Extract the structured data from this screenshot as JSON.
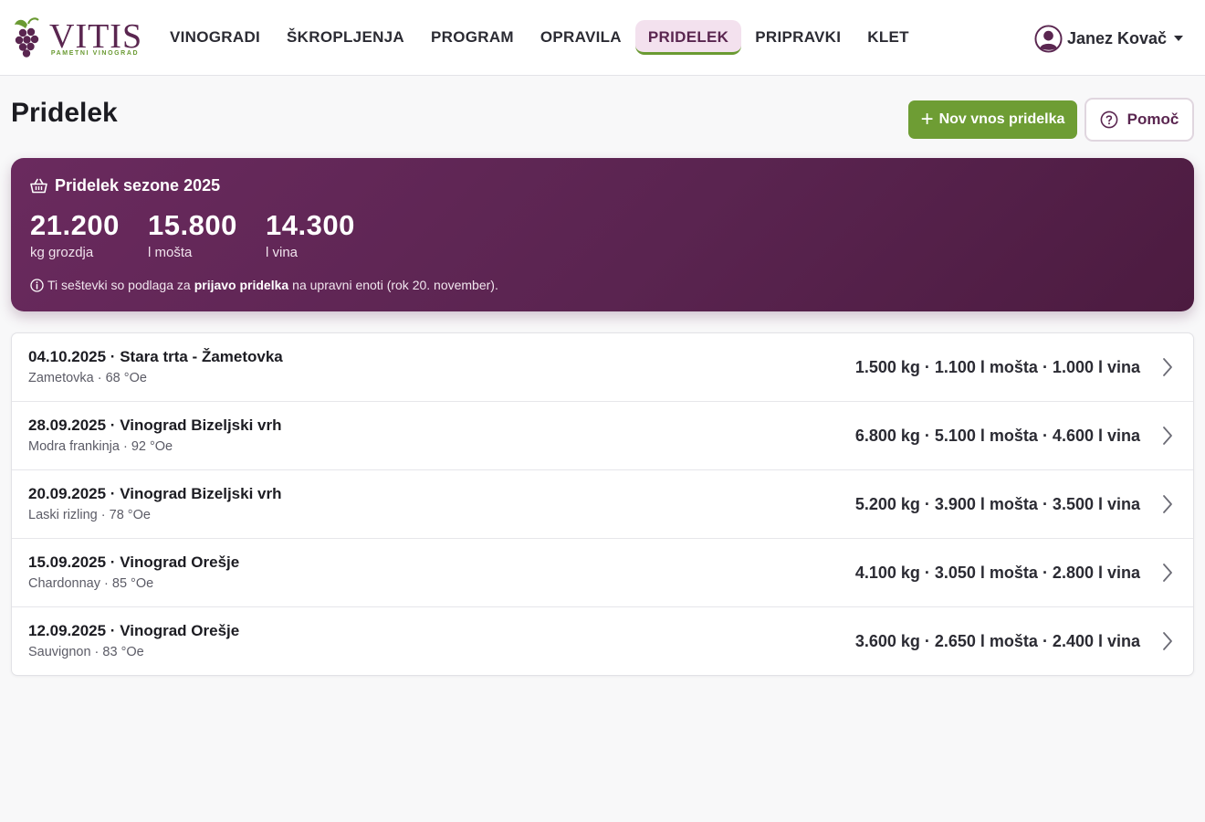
{
  "brand": {
    "name": "VITIS",
    "tagline": "PAMETNI VINOGRAD"
  },
  "nav": {
    "items": [
      {
        "label": "VINOGRADI",
        "active": false
      },
      {
        "label": "ŠKROPLJENJA",
        "active": false
      },
      {
        "label": "PROGRAM",
        "active": false
      },
      {
        "label": "OPRAVILA",
        "active": false
      },
      {
        "label": "PRIDELEK",
        "active": true
      },
      {
        "label": "PRIPRAVKI",
        "active": false
      },
      {
        "label": "KLET",
        "active": false
      }
    ]
  },
  "user": {
    "name": "Janez Kovač",
    "icon": "user-circle-icon"
  },
  "page": {
    "title": "Pridelek",
    "new_button": "Nov vnos pridelka",
    "help_button": "Pomoč"
  },
  "season": {
    "title": "Pridelek sezone 2025",
    "icon": "basket-icon",
    "stats": [
      {
        "value": "21.200",
        "label": "kg grozdja"
      },
      {
        "value": "15.800",
        "label": "l mošta"
      },
      {
        "value": "14.300",
        "label": "l vina"
      }
    ],
    "note_before": "Ti seštevki so podlaga za",
    "note_bold": "prijavo pridelka",
    "note_after": "na upravni enoti (rok 20. november)."
  },
  "entries": [
    {
      "title": "04.10.2025 · Stara trta - Žametovka",
      "sub": "Zametovka · 68 °Oe",
      "values": "1.500 kg · 1.100 l mošta · 1.000 l vina"
    },
    {
      "title": "28.09.2025 · Vinograd Bizeljski vrh",
      "sub": "Modra frankinja · 92 °Oe",
      "values": "6.800 kg · 5.100 l mošta · 4.600 l vina"
    },
    {
      "title": "20.09.2025 · Vinograd Bizeljski vrh",
      "sub": "Laski rizling · 78 °Oe",
      "values": "5.200 kg · 3.900 l mošta · 3.500 l vina"
    },
    {
      "title": "15.09.2025 · Vinograd Orešje",
      "sub": "Chardonnay · 85 °Oe",
      "values": "4.100 kg · 3.050 l mošta · 2.800 l vina"
    },
    {
      "title": "12.09.2025 · Vinograd Orešje",
      "sub": "Sauvignon · 83 °Oe",
      "values": "3.600 kg · 2.650 l mošta · 2.400 l vina"
    }
  ],
  "colors": {
    "brand_purple": "#5a2650",
    "accent_green": "#6e9d34",
    "active_tab_bg": "#f3e1ee"
  }
}
